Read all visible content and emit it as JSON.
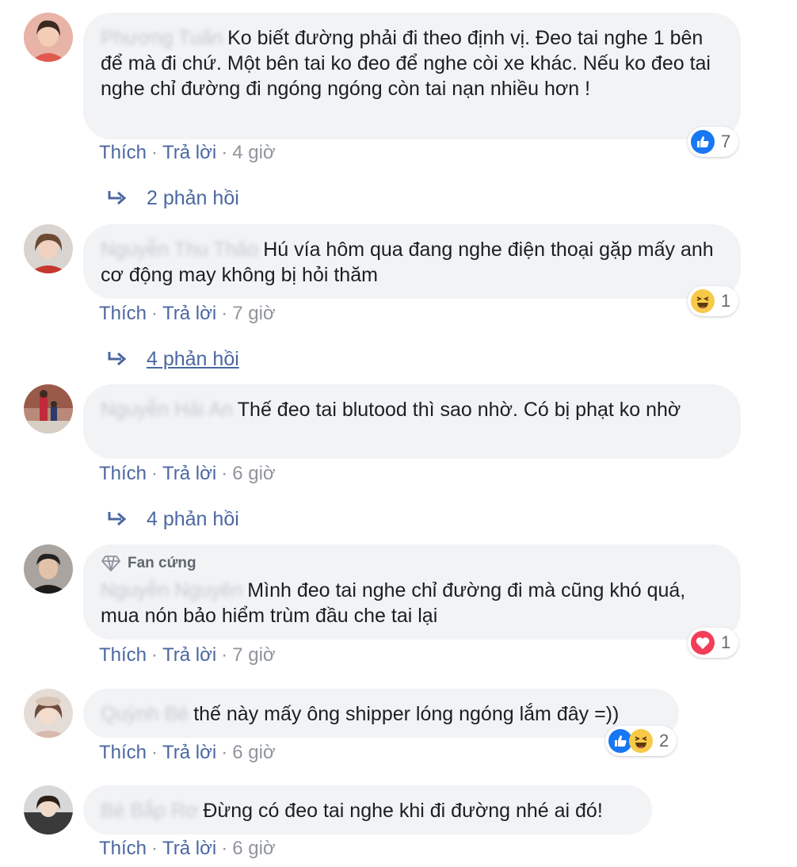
{
  "colors": {
    "link": "#4b67a1",
    "meta": "#90949c",
    "bubble": "#f2f3f5",
    "like_blue": "#1877f2",
    "love_red": "#f33e58",
    "haha_yellow": "#f7c948"
  },
  "comments": [
    {
      "author": "Phương Tuấn",
      "text": "Ko biết đường phải đi theo định vị. Đeo tai nghe 1 bên để mà đi chứ. Một bên tai ko đeo để nghe còi xe khác. Nếu ko đeo tai nghe chỉ đường đi ngóng ngóng còn tai nạn nhiều hơn !",
      "like_label": "Thích",
      "reply_label": "Trả lời",
      "time": "4 giờ",
      "reactions": [
        "like-icon"
      ],
      "reaction_count": "7",
      "replies_label": "2 phản hồi"
    },
    {
      "author": "Nguyễn Thu Thảo",
      "text": "Hú vía hôm qua đang nghe điện thoại gặp mấy anh cơ động may không bị hỏi thăm",
      "like_label": "Thích",
      "reply_label": "Trả lời",
      "time": "7 giờ",
      "reactions": [
        "haha-icon"
      ],
      "reaction_count": "1",
      "replies_label": "4 phản hồi"
    },
    {
      "author": "Nguyễn Hải An",
      "text": "Thế đeo tai blutood thì sao nhờ. Có bị phạt ko nhờ",
      "like_label": "Thích",
      "reply_label": "Trả lời",
      "time": "6 giờ",
      "replies_label": "4 phản hồi"
    },
    {
      "badge": "Fan cứng",
      "author": "Nguyễn Nguyên",
      "text": "Mình đeo tai nghe chỉ đường đi mà cũng khó quá, mua nón bảo hiểm trùm đầu che tai lại",
      "like_label": "Thích",
      "reply_label": "Trả lời",
      "time": "7 giờ",
      "reactions": [
        "love-icon"
      ],
      "reaction_count": "1"
    },
    {
      "author": "Quỳnh Bé",
      "text": "thế này mấy ông shipper lóng ngóng lắm đây =))",
      "like_label": "Thích",
      "reply_label": "Trả lời",
      "time": "6 giờ",
      "reactions": [
        "like-icon",
        "haha-icon"
      ],
      "reaction_count": "2"
    },
    {
      "author": "Bé Bắp Rơ",
      "text": "Đừng có đeo tai nghe khi đi đường nhé ai đó!",
      "like_label": "Thích",
      "reply_label": "Trả lời",
      "time": "6 giờ"
    }
  ]
}
